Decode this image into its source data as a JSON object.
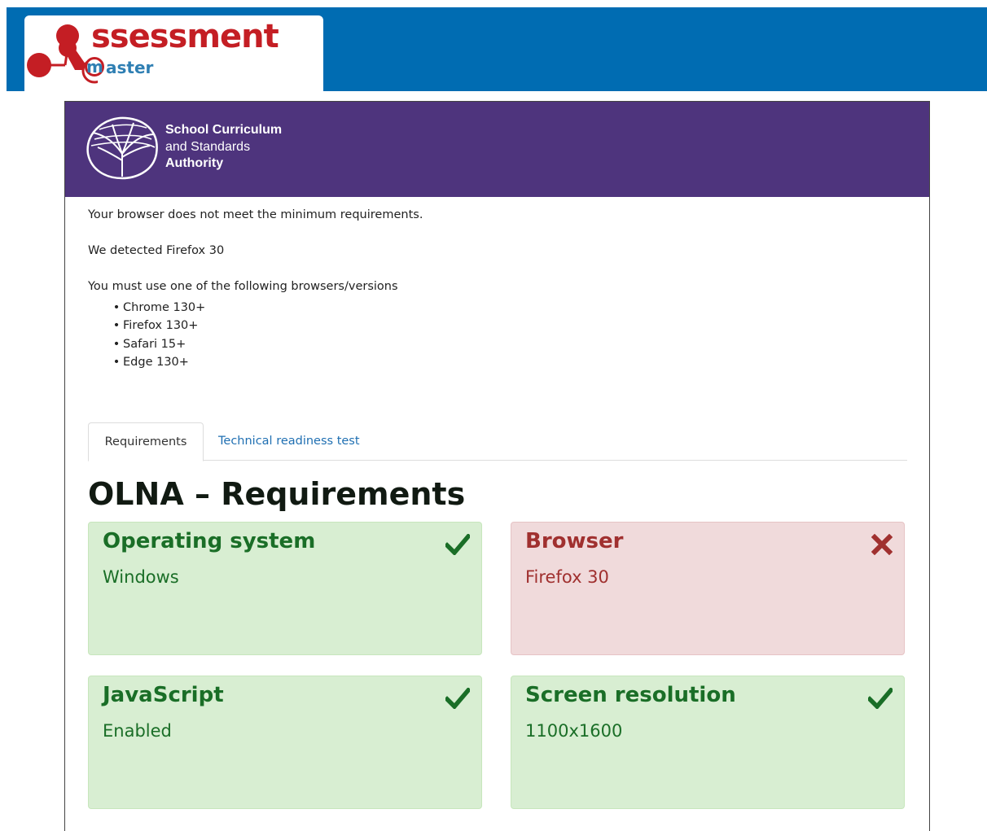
{
  "branding": {
    "logo_text": "ssessment",
    "logo_sub": "aster",
    "logo_m": "m",
    "brand_red": "#c41e24",
    "brand_blue": "#2f7fb3",
    "topbar_color": "#006cb2"
  },
  "authority": {
    "line1": "School Curriculum",
    "line2": "and Standards",
    "line3": "Authority",
    "header_color": "#4e347d"
  },
  "message": {
    "not_met": "Your browser does not meet the minimum requirements.",
    "detected": "We detected Firefox 30",
    "must_use": "You must use one of the following browsers/versions",
    "browsers": [
      "Chrome 130+",
      "Firefox 130+",
      "Safari 15+",
      "Edge 130+"
    ]
  },
  "tabs": [
    {
      "label": "Requirements",
      "active": true
    },
    {
      "label": "Technical readiness test",
      "active": false
    }
  ],
  "page_title": "OLNA – Requirements",
  "requirements": [
    {
      "title": "Operating system",
      "value": "Windows",
      "status": "ok",
      "icon": "checkmark-icon"
    },
    {
      "title": "Browser",
      "value": "Firefox 30",
      "status": "fail",
      "icon": "cross-icon"
    },
    {
      "title": "JavaScript",
      "value": "Enabled",
      "status": "ok",
      "icon": "checkmark-icon"
    },
    {
      "title": "Screen resolution",
      "value": "1100x1600",
      "status": "ok",
      "icon": "checkmark-icon"
    }
  ],
  "colors": {
    "ok_bg": "#d8eed2",
    "ok_text": "#1a6e27",
    "fail_bg": "#f0dadb",
    "fail_text": "#a0302f",
    "link": "#1f6fb2"
  }
}
